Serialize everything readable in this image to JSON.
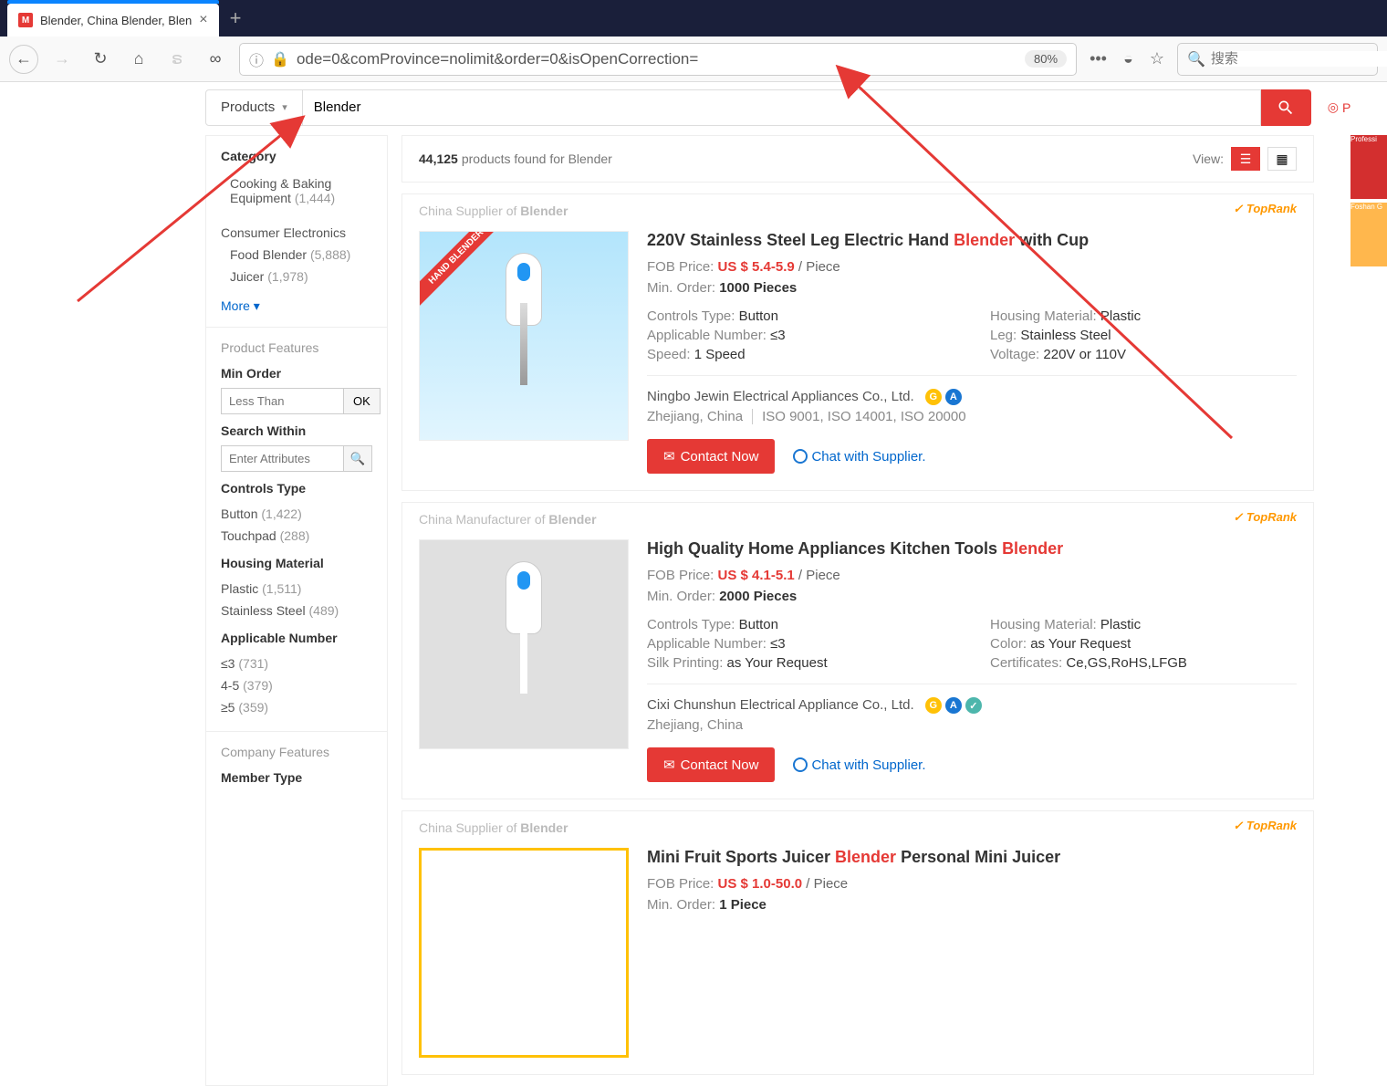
{
  "browser": {
    "tab_title": "Blender, China Blender, Blen",
    "url": "ode=0&comProvince=nolimit&order=0&isOpenCorrection=",
    "zoom": "80%",
    "search_placeholder": "搜索"
  },
  "search": {
    "category_label": "Products",
    "query": "Blender",
    "post_req": "P"
  },
  "results_meta": {
    "count": "44,125",
    "text": "products found for Blender",
    "view_label": "View:"
  },
  "sidebar": {
    "category_title": "Category",
    "cooking": {
      "label": "Cooking & Baking Equipment",
      "count": "(1,444)"
    },
    "consumer_title": "Consumer Electronics",
    "food_blender": {
      "label": "Food Blender",
      "count": "(5,888)"
    },
    "juicer": {
      "label": "Juicer",
      "count": "(1,978)"
    },
    "more": "More",
    "features_title": "Product Features",
    "min_order_label": "Min Order",
    "min_order_placeholder": "Less Than",
    "ok": "OK",
    "search_within_label": "Search Within",
    "search_within_placeholder": "Enter Attributes",
    "controls_type_label": "Controls Type",
    "button": {
      "label": "Button",
      "count": "(1,422)"
    },
    "touchpad": {
      "label": "Touchpad",
      "count": "(288)"
    },
    "housing_label": "Housing Material",
    "plastic": {
      "label": "Plastic",
      "count": "(1,511)"
    },
    "stainless": {
      "label": "Stainless Steel",
      "count": "(489)"
    },
    "applicable_label": "Applicable Number",
    "le3": {
      "label": "≤3",
      "count": "(731)"
    },
    "r45": {
      "label": "4-5",
      "count": "(379)"
    },
    "ge5": {
      "label": "≥5",
      "count": "(359)"
    },
    "company_features": "Company Features",
    "member_type": "Member Type"
  },
  "products": [
    {
      "supplier_prefix": "China Supplier of ",
      "supplier_hl": "Blender",
      "toprank": "TopRank",
      "ribbon": "HAND BLENDER",
      "title_pre": "220V Stainless Steel Leg Electric Hand ",
      "title_hl": "Blender",
      "title_post": " with Cup",
      "fob_label": "FOB Price:",
      "price": "US $ 5.4-5.9",
      "unit": "/ Piece",
      "min_label": "Min. Order:",
      "min_val": "1000 Pieces",
      "specs": {
        "controls_l": "Controls Type:",
        "controls_v": "Button",
        "housing_l": "Housing Material:",
        "housing_v": "Plastic",
        "applicable_l": "Applicable Number:",
        "applicable_v": "≤3",
        "leg_l": "Leg:",
        "leg_v": "Stainless Steel",
        "speed_l": "Speed:",
        "speed_v": "1 Speed",
        "voltage_l": "Voltage:",
        "voltage_v": "220V or 110V"
      },
      "company": "Ningbo Jewin Electrical Appliances Co., Ltd.",
      "location": "Zhejiang, China",
      "iso": "ISO 9001, ISO 14001, ISO 20000",
      "contact": "Contact Now",
      "chat": "Chat with Supplier."
    },
    {
      "supplier_prefix": "China Manufacturer of ",
      "supplier_hl": "Blender",
      "toprank": "TopRank",
      "title_pre": "High Quality Home Appliances Kitchen Tools ",
      "title_hl": "Blender",
      "title_post": "",
      "fob_label": "FOB Price:",
      "price": "US $ 4.1-5.1",
      "unit": "/ Piece",
      "min_label": "Min. Order:",
      "min_val": "2000 Pieces",
      "specs": {
        "controls_l": "Controls Type:",
        "controls_v": "Button",
        "housing_l": "Housing Material:",
        "housing_v": "Plastic",
        "applicable_l": "Applicable Number:",
        "applicable_v": "≤3",
        "color_l": "Color:",
        "color_v": "as Your Request",
        "silk_l": "Silk Printing:",
        "silk_v": "as Your Request",
        "cert_l": "Certificates:",
        "cert_v": "Ce,GS,RoHS,LFGB"
      },
      "company": "Cixi Chunshun Electrical Appliance Co., Ltd.",
      "location": "Zhejiang, China",
      "contact": "Contact Now",
      "chat": "Chat with Supplier."
    },
    {
      "supplier_prefix": "China Supplier of ",
      "supplier_hl": "Blender",
      "toprank": "TopRank",
      "title_pre": "Mini Fruit Sports Juicer ",
      "title_hl": "Blender",
      "title_post": " Personal Mini Juicer",
      "fob_label": "FOB Price:",
      "price": "US $ 1.0-50.0",
      "unit": "/ Piece",
      "min_label": "Min. Order:",
      "min_val": "1 Piece"
    }
  ],
  "thumbs": {
    "t1": "Professi",
    "t2": "Foshan G"
  }
}
